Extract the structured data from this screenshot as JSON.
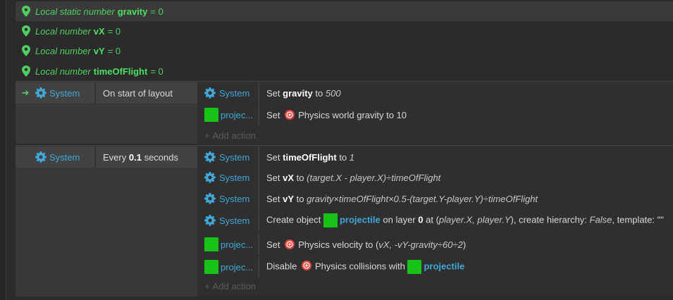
{
  "variables": [
    {
      "keyword": "Local static number",
      "name": "gravity",
      "value": "= 0"
    },
    {
      "keyword": "Local number",
      "name": "vX",
      "value": "= 0"
    },
    {
      "keyword": "Local number",
      "name": "vY",
      "value": "= 0"
    },
    {
      "keyword": "Local number",
      "name": "timeOfFlight",
      "value": "= 0"
    }
  ],
  "events": [
    {
      "condition": {
        "object": "System",
        "text": "On start of layout"
      },
      "actions": [
        {
          "object": "System",
          "prefix": "Set",
          "bold": "gravity",
          "mid": "to",
          "ital": "500"
        },
        {
          "object": "projec...",
          "prefix": "Set",
          "rest": "Physics world gravity to 10"
        }
      ],
      "add_action": "Add action"
    },
    {
      "condition": {
        "object": "System",
        "prefix": "Every",
        "bold": "0.1",
        "suffix": "seconds"
      },
      "actions": [
        {
          "object": "System",
          "prefix": "Set",
          "bold": "timeOfFlight",
          "mid": "to",
          "ital": "1"
        },
        {
          "object": "System",
          "prefix": "Set",
          "bold": "vX",
          "mid": "to",
          "ital": "(target.X - player.X)÷timeOfFlight"
        },
        {
          "object": "System",
          "prefix": "Set",
          "bold": "vY",
          "mid": "to",
          "ital": "gravity×timeOfFlight×0.5-(target.Y-player.Y)÷timeOfFlight"
        },
        {
          "object": "System",
          "p1": "Create object",
          "obj": "projectile",
          "p2": "on layer",
          "layer": "0",
          "p3": "at (",
          "pos": "player.X, player.Y",
          "p4": "), create hierarchy:",
          "hier": "False",
          "p5": ", template: \"\""
        },
        {
          "object": "projec...",
          "prefix": "Set",
          "rest": "Physics velocity to (",
          "ital": "vX, -vY-gravity÷60÷2",
          "end": ")"
        },
        {
          "object": "projec...",
          "prefix": "Disable",
          "rest": "Physics collisions with",
          "obj": "projectile"
        }
      ],
      "add_action": "Add action"
    }
  ],
  "colors": {
    "variable": "#4fcf62",
    "object": "#41a7d8",
    "swatch": "#18c318",
    "physics": "#e0443a"
  }
}
